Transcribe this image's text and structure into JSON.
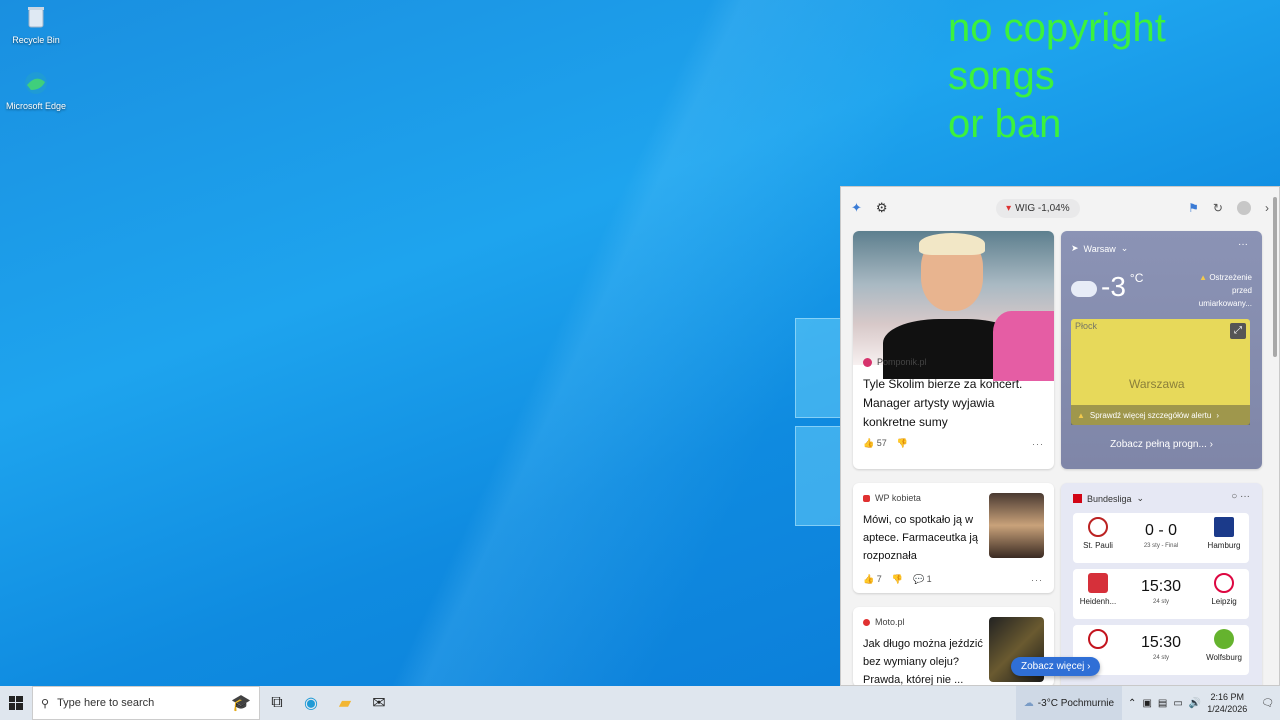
{
  "desktop": {
    "icons": [
      {
        "label": "Recycle Bin"
      },
      {
        "label": "Microsoft Edge"
      }
    ]
  },
  "overlay": {
    "line1": "no copyright songs",
    "line2": "or ban"
  },
  "widgets": {
    "stock": {
      "label": "WIG -1,04%"
    },
    "hero": {
      "source": "Pomponik.pl",
      "headline": "Tyle Skolim bierze za koncert. Manager artysty wyjawia konkretne sumy",
      "likes": "57"
    },
    "weather": {
      "location": "Warsaw",
      "temp": "-3",
      "unit": "°C",
      "alert": "Ostrzeżenie przed umiarkowany...",
      "map_city": "Warszawa",
      "map_corner": "Płock",
      "alert_details": "Sprawdź więcej szczegółów alertu",
      "full_forecast": "Zobacz pełną progn..."
    },
    "news2": {
      "source": "WP kobieta",
      "headline": "Mówi, co spotkało ją w aptece. Farmaceutka ją rozpoznała",
      "likes": "7",
      "comments": "1"
    },
    "news3": {
      "source": "Moto.pl",
      "headline": "Jak długo można jeździć bez wymiany oleju? Prawda, której nie ..."
    },
    "sports": {
      "league": "Bundesliga",
      "matches": [
        {
          "home": "St. Pauli",
          "away": "Hamburg",
          "score": "0 - 0",
          "info": "23 sty - Final"
        },
        {
          "home": "Heidenh...",
          "away": "Leipzig",
          "score": "15:30",
          "info": "24 sty"
        },
        {
          "home": "",
          "away": "Wolfsburg",
          "score": "15:30",
          "info": "24 sty"
        }
      ]
    },
    "see_more": "Zobacz więcej"
  },
  "taskbar": {
    "search_placeholder": "Type here to search",
    "weather": "-3°C  Pochmurnie",
    "time": "2:16 PM",
    "date": "1/24/2026"
  },
  "colors": {
    "overlay_text": "#3cf23c",
    "accent": "#2f6fd6"
  }
}
